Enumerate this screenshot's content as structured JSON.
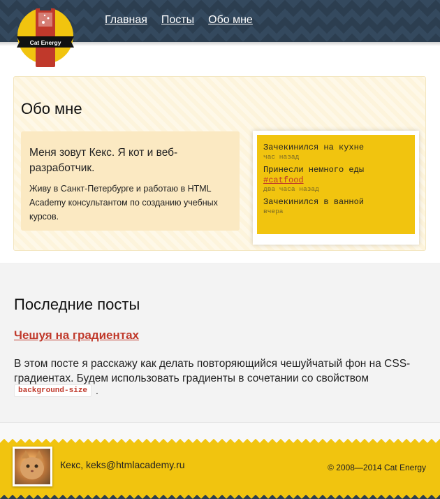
{
  "nav": {
    "items": [
      {
        "label": "Главная"
      },
      {
        "label": "Посты"
      },
      {
        "label": "Обо мне"
      }
    ]
  },
  "logo": {
    "text": "Cat Energy"
  },
  "about": {
    "title": "Обо мне",
    "headline": "Меня зовут Кекс. Я кот и веб-разработчик.",
    "text": "Живу в Санкт-Петербурге и работаю в HTML Academy консультантом по созданию учебных курсов."
  },
  "timeline": {
    "items": [
      {
        "text": "Зачекинился на кухне",
        "tag": "",
        "time": "час назад"
      },
      {
        "text": "Принесли немного еды",
        "tag": "#catfood",
        "time": "два часа назад"
      },
      {
        "text": "Зачекинился в ванной",
        "tag": "",
        "time": "вчера"
      }
    ]
  },
  "posts": {
    "title": "Последние посты",
    "post_title": "Чешуя на градиентах",
    "post_text": "В этом посте я расскажу как делать повторяющийся чешуйчатый фон на CSS-градиентах. Будем использовать градиенты в сочетании со свойством",
    "post_code": "background-size",
    "post_end": "."
  },
  "footer": {
    "contact": "Кекс, keks@htmlacademy.ru",
    "copyright": "© 2008—2014 Cat Energy"
  },
  "colors": {
    "header_bg": "#2c3e50",
    "accent_yellow": "#f1c40f",
    "link_red": "#c0392b"
  }
}
